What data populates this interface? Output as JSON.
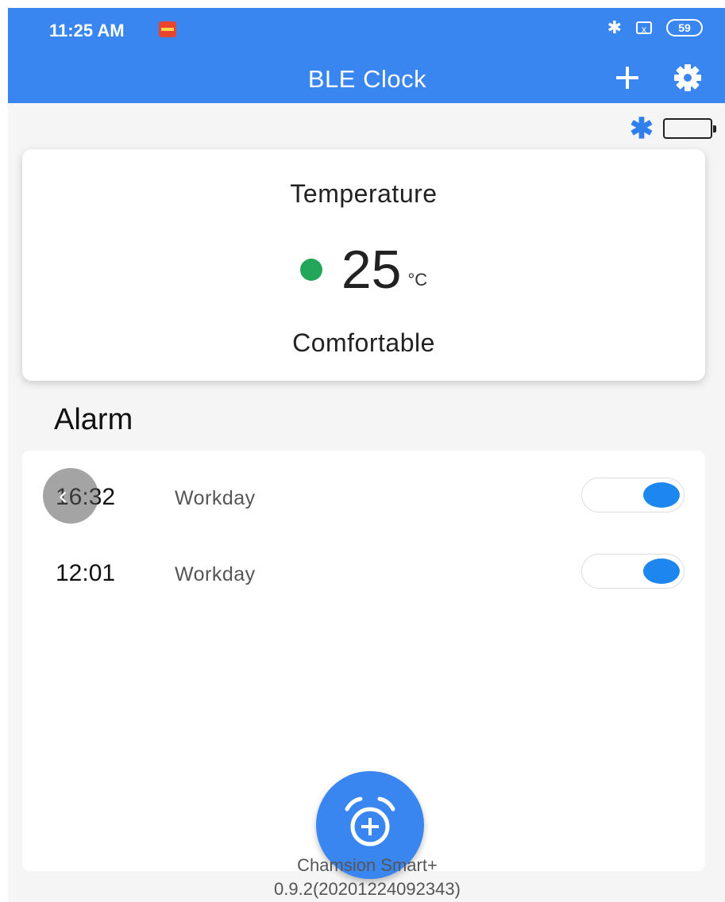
{
  "status_bar": {
    "time": "11:25 AM",
    "bluetooth_glyph": "✱",
    "sim_glyph": "x",
    "battery_level": "59"
  },
  "app_bar": {
    "title": "BLE Clock",
    "add_icon": "plus-icon",
    "settings_icon": "gear-icon"
  },
  "device_status": {
    "bluetooth_glyph": "✱",
    "battery_icon": "battery-empty-icon"
  },
  "temperature": {
    "title": "Temperature",
    "value": "25",
    "unit": "°C",
    "status": "Comfortable",
    "status_color": "#23a55a"
  },
  "alarm": {
    "heading": "Alarm",
    "items": [
      {
        "time": "16:32",
        "repeat": "Workday",
        "enabled": true
      },
      {
        "time": "12:01",
        "repeat": "Workday",
        "enabled": true
      }
    ]
  },
  "back_gesture_glyph": "‹",
  "fab_icon": "alarm-add-icon",
  "footer": {
    "app_name": "Chamsion Smart+",
    "version": "0.9.2(20201224092343)"
  },
  "colors": {
    "accent": "#3a86f0",
    "toggle_on": "#1e87ef"
  }
}
